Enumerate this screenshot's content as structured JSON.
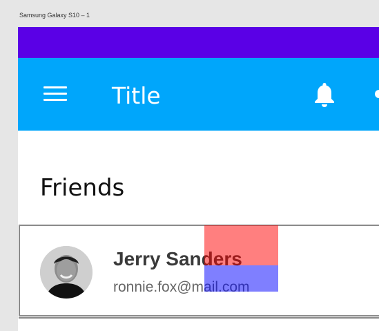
{
  "artboard": {
    "label": "Samsung Galaxy S10 – 1"
  },
  "colors": {
    "status_bar": "#5a00e6",
    "app_bar": "#00a6fb",
    "overlay_red": "#ff0000",
    "overlay_blue": "#0000ff"
  },
  "app_bar": {
    "title": "Title",
    "icons": [
      "menu-icon",
      "bell-icon",
      "more-vert-icon"
    ]
  },
  "friends": {
    "heading": "Friends",
    "items": [
      {
        "name": "Jerry Sanders",
        "email": "ronnie.fox@mail.com",
        "avatar": "avatar-photo"
      }
    ]
  }
}
